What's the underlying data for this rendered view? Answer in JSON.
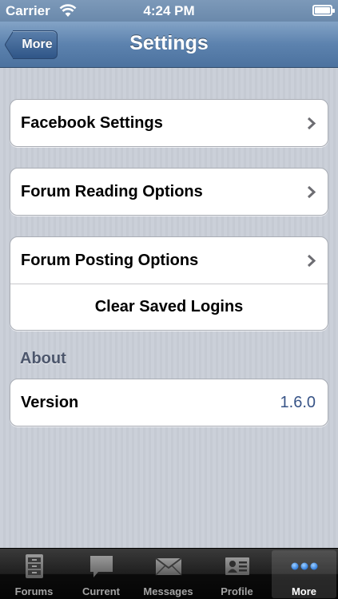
{
  "status_bar": {
    "carrier": "Carrier",
    "time": "4:24 PM"
  },
  "nav": {
    "back_label": "More",
    "title": "Settings"
  },
  "groups": {
    "facebook": {
      "label": "Facebook Settings"
    },
    "reading": {
      "label": "Forum Reading Options"
    },
    "posting": {
      "label": "Forum Posting Options",
      "clear_logins": "Clear Saved Logins"
    },
    "about": {
      "header": "About",
      "version_label": "Version",
      "version_value": "1.6.0"
    }
  },
  "tabs": [
    {
      "label": "Forums",
      "icon": "cabinet-icon"
    },
    {
      "label": "Current",
      "icon": "speech-bubble-icon"
    },
    {
      "label": "Messages",
      "icon": "envelope-icon"
    },
    {
      "label": "Profile",
      "icon": "id-card-icon"
    },
    {
      "label": "More",
      "icon": "more-dots-icon",
      "active": true
    }
  ],
  "colors": {
    "accent_value": "#385487",
    "active_tab_dots": "#3b8bf0"
  }
}
